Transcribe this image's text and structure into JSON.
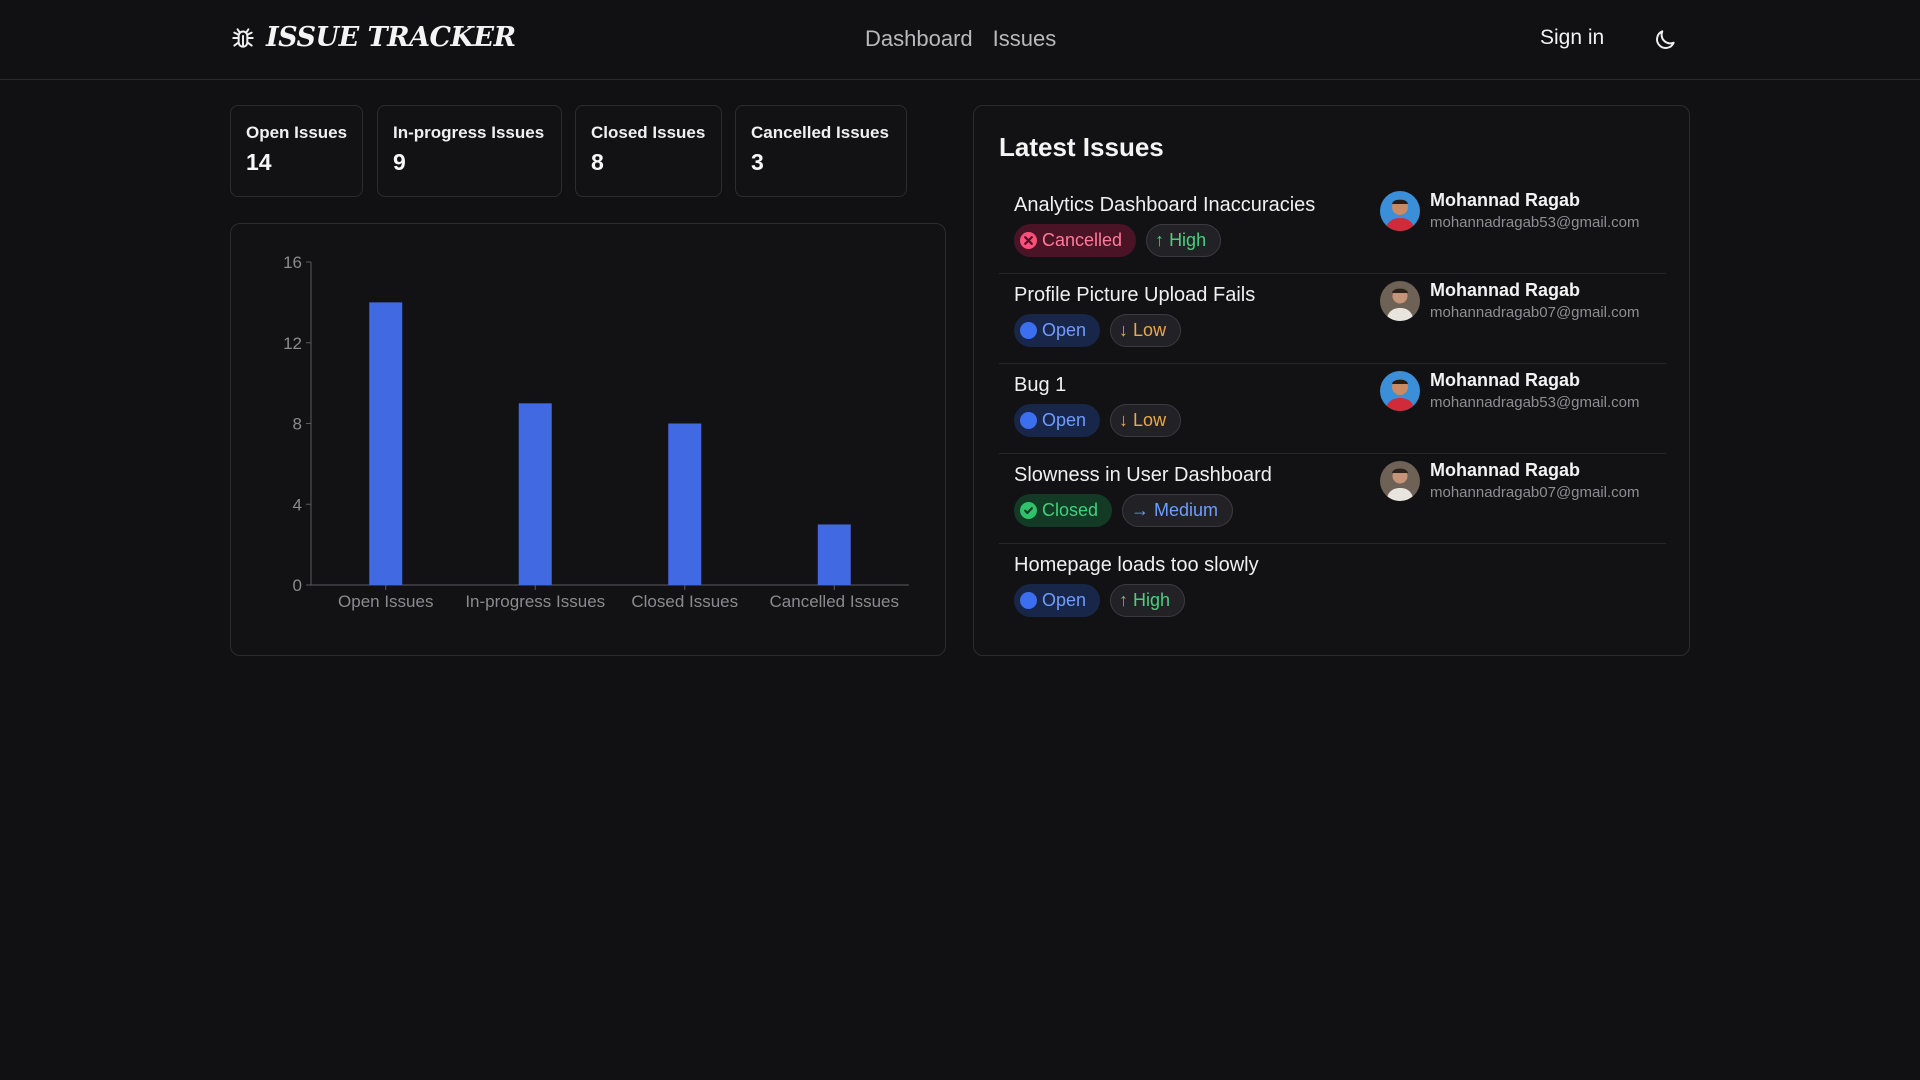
{
  "header": {
    "logo_text": "ISSUE TRACKER",
    "nav": [
      {
        "label": "Dashboard"
      },
      {
        "label": "Issues"
      }
    ],
    "signin_label": "Sign in"
  },
  "summary": [
    {
      "label": "Open Issues",
      "value": "14"
    },
    {
      "label": "In-progress Issues",
      "value": "9"
    },
    {
      "label": "Closed Issues",
      "value": "8"
    },
    {
      "label": "Cancelled Issues",
      "value": "3"
    }
  ],
  "chart_data": {
    "type": "bar",
    "categories": [
      "Open Issues",
      "In-progress Issues",
      "Closed Issues",
      "Cancelled Issues"
    ],
    "values": [
      14,
      9,
      8,
      3
    ],
    "yticks": [
      0,
      4,
      8,
      12,
      16
    ],
    "ylim": [
      0,
      16
    ],
    "title": "",
    "xlabel": "",
    "ylabel": "",
    "bar_color": "#4169e1",
    "grid": false
  },
  "latest": {
    "title": "Latest Issues",
    "issues": [
      {
        "title": "Analytics Dashboard Inaccuracies",
        "status": "Cancelled",
        "priority": "High",
        "assignee_name": "Mohannad Ragab",
        "assignee_email": "mohannadragab53@gmail.com"
      },
      {
        "title": "Profile Picture Upload Fails",
        "status": "Open",
        "priority": "Low",
        "assignee_name": "Mohannad Ragab",
        "assignee_email": "mohannadragab07@gmail.com"
      },
      {
        "title": "Bug 1",
        "status": "Open",
        "priority": "Low",
        "assignee_name": "Mohannad Ragab",
        "assignee_email": "mohannadragab53@gmail.com"
      },
      {
        "title": "Slowness in User Dashboard",
        "status": "Closed",
        "priority": "Medium",
        "assignee_name": "Mohannad Ragab",
        "assignee_email": "mohannadragab07@gmail.com"
      },
      {
        "title": "Homepage loads too slowly",
        "status": "Open",
        "priority": "High"
      }
    ]
  },
  "colors": {
    "background": "#111113",
    "accent_bar": "#4169e1",
    "status_open": "#6f9dff",
    "status_closed": "#42d07c",
    "status_cancelled": "#ff7b9b",
    "priority_low": "#e9a84d"
  },
  "icons": {
    "logo": "bug-icon",
    "theme": "moon-icon"
  }
}
